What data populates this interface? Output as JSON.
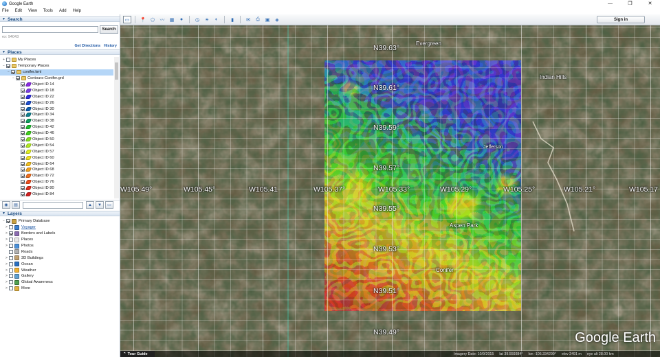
{
  "window": {
    "title": "Google Earth",
    "minimize": "—",
    "restore": "❐",
    "close": "✕"
  },
  "menu": [
    "File",
    "Edit",
    "View",
    "Tools",
    "Add",
    "Help"
  ],
  "search": {
    "header": "Search",
    "button": "Search",
    "hint": "ex: 94043",
    "links": [
      "Get Directions",
      "History"
    ]
  },
  "places": {
    "header": "Places",
    "items": [
      {
        "label": "My Places",
        "indent": 0,
        "checked": false,
        "exp": "+",
        "icon": "folder"
      },
      {
        "label": "Temporary Places",
        "indent": 0,
        "checked": true,
        "exp": "−",
        "icon": "folder"
      },
      {
        "label": "conifer.kml",
        "indent": 1,
        "checked": true,
        "exp": "−",
        "icon": "folder",
        "selected": true
      },
      {
        "label": "Contours-Conifer.grd",
        "indent": 2,
        "checked": true,
        "exp": "−",
        "icon": "folder"
      },
      {
        "label": "Object ID 14",
        "indent": 3,
        "checked": true,
        "color": "#8a2be2"
      },
      {
        "label": "Object ID 18",
        "indent": 3,
        "checked": true,
        "color": "#7b3fe4"
      },
      {
        "label": "Object ID 22",
        "indent": 3,
        "checked": true,
        "color": "#3030e0"
      },
      {
        "label": "Object ID 26",
        "indent": 3,
        "checked": true,
        "color": "#2050d0"
      },
      {
        "label": "Object ID 30",
        "indent": 3,
        "checked": true,
        "color": "#1060b0"
      },
      {
        "label": "Object ID 34",
        "indent": 3,
        "checked": true,
        "color": "#108090"
      },
      {
        "label": "Object ID 38",
        "indent": 3,
        "checked": true,
        "color": "#10a060"
      },
      {
        "label": "Object ID 42",
        "indent": 3,
        "checked": true,
        "color": "#20c030"
      },
      {
        "label": "Object ID 46",
        "indent": 3,
        "checked": true,
        "color": "#40d020"
      },
      {
        "label": "Object ID 50",
        "indent": 3,
        "checked": true,
        "color": "#80e020"
      },
      {
        "label": "Object ID 54",
        "indent": 3,
        "checked": true,
        "color": "#b0e820"
      },
      {
        "label": "Object ID 57",
        "indent": 3,
        "checked": true,
        "color": "#e0f020"
      },
      {
        "label": "Object ID 60",
        "indent": 3,
        "checked": true,
        "color": "#f0e020"
      },
      {
        "label": "Object ID 64",
        "indent": 3,
        "checked": true,
        "color": "#f0c020"
      },
      {
        "label": "Object ID 68",
        "indent": 3,
        "checked": true,
        "color": "#f0a020"
      },
      {
        "label": "Object ID 72",
        "indent": 3,
        "checked": true,
        "color": "#f07020"
      },
      {
        "label": "Object ID 76",
        "indent": 3,
        "checked": true,
        "color": "#f05020"
      },
      {
        "label": "Object ID 80",
        "indent": 3,
        "checked": true,
        "color": "#e03020"
      },
      {
        "label": "Object ID 84",
        "indent": 3,
        "checked": true,
        "color": "#d02020"
      }
    ]
  },
  "layers": {
    "header": "Layers",
    "items": [
      {
        "label": "Primary Database",
        "indent": 0,
        "checked": true,
        "exp": "−",
        "icon": "#c8a040"
      },
      {
        "label": "Voyager",
        "indent": 1,
        "checked": false,
        "exp": ">",
        "icon": "#3a7fd0",
        "link": true
      },
      {
        "label": "Borders and Labels",
        "indent": 1,
        "checked": true,
        "exp": ">",
        "icon": "#8a6bb0"
      },
      {
        "label": "Places",
        "indent": 1,
        "checked": false,
        "exp": ">",
        "icon": "#e8e8e8"
      },
      {
        "label": "Photos",
        "indent": 1,
        "checked": false,
        "exp": ">",
        "icon": "#4a90d9"
      },
      {
        "label": "Roads",
        "indent": 1,
        "checked": false,
        "exp": "",
        "icon": "#b0b0b0"
      },
      {
        "label": "3D Buildings",
        "indent": 1,
        "checked": false,
        "exp": ">",
        "icon": "#c0a070"
      },
      {
        "label": "Ocean",
        "indent": 1,
        "checked": false,
        "exp": ">",
        "icon": "#2a6fc0"
      },
      {
        "label": "Weather",
        "indent": 1,
        "checked": false,
        "exp": ">",
        "icon": "#f0b030"
      },
      {
        "label": "Gallery",
        "indent": 1,
        "checked": false,
        "exp": ">",
        "icon": "#60a0d0"
      },
      {
        "label": "Global Awareness",
        "indent": 1,
        "checked": false,
        "exp": ">",
        "icon": "#50a050"
      },
      {
        "label": "More",
        "indent": 1,
        "checked": false,
        "exp": ">",
        "icon": "#e0b040"
      }
    ]
  },
  "toolbar": {
    "signin": "Sign in"
  },
  "map": {
    "lon_labels": [
      "W105.49°",
      "W105.45°",
      "W105.41",
      "W105.37°",
      "W105.33°",
      "W105.29°",
      "W105.25°",
      "W105.21°",
      "W105.17"
    ],
    "lat_labels": [
      "N39.63°",
      "N39.61°",
      "N39.59°",
      "N39.57°",
      "N39.55°",
      "N39.53°",
      "N39.51°",
      "N39.49°"
    ],
    "places": [
      "Evergreen",
      "Indian Hills",
      "Jefferson",
      "Aspen Park",
      "Conifer"
    ],
    "brand": "Google Earth",
    "tour_guide": "Tour Guide",
    "status": [
      "Imagery Date: 10/9/2015",
      "lat  39.559384°",
      "lon -105.334299°",
      "elev  2491 m",
      "eye alt  28.00 km"
    ]
  }
}
